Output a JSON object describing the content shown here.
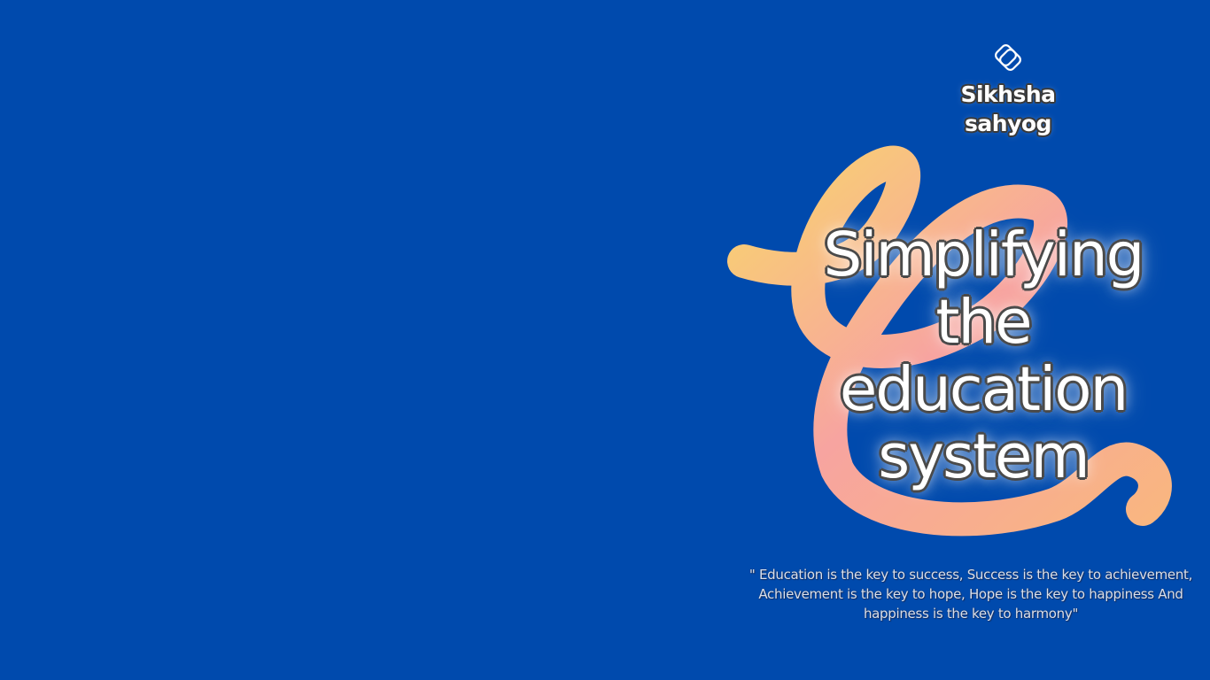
{
  "background_color": "#004aad",
  "logo": {
    "icon": "diamond-rings-icon",
    "brand_name": "Sikhsha\nsahyog"
  },
  "headline": {
    "lines": [
      "Simplifying",
      "the",
      "education",
      "system"
    ]
  },
  "quote": {
    "text": "\" Education is the key to success, Success is the key to achievement, Achievement is the key to hope, Hope is the key to happiness And happiness is the key to harmony\""
  },
  "colors": {
    "ribbon_start": "#f9d46e",
    "ribbon_end": "#f7a19b",
    "text": "#ffffff"
  }
}
